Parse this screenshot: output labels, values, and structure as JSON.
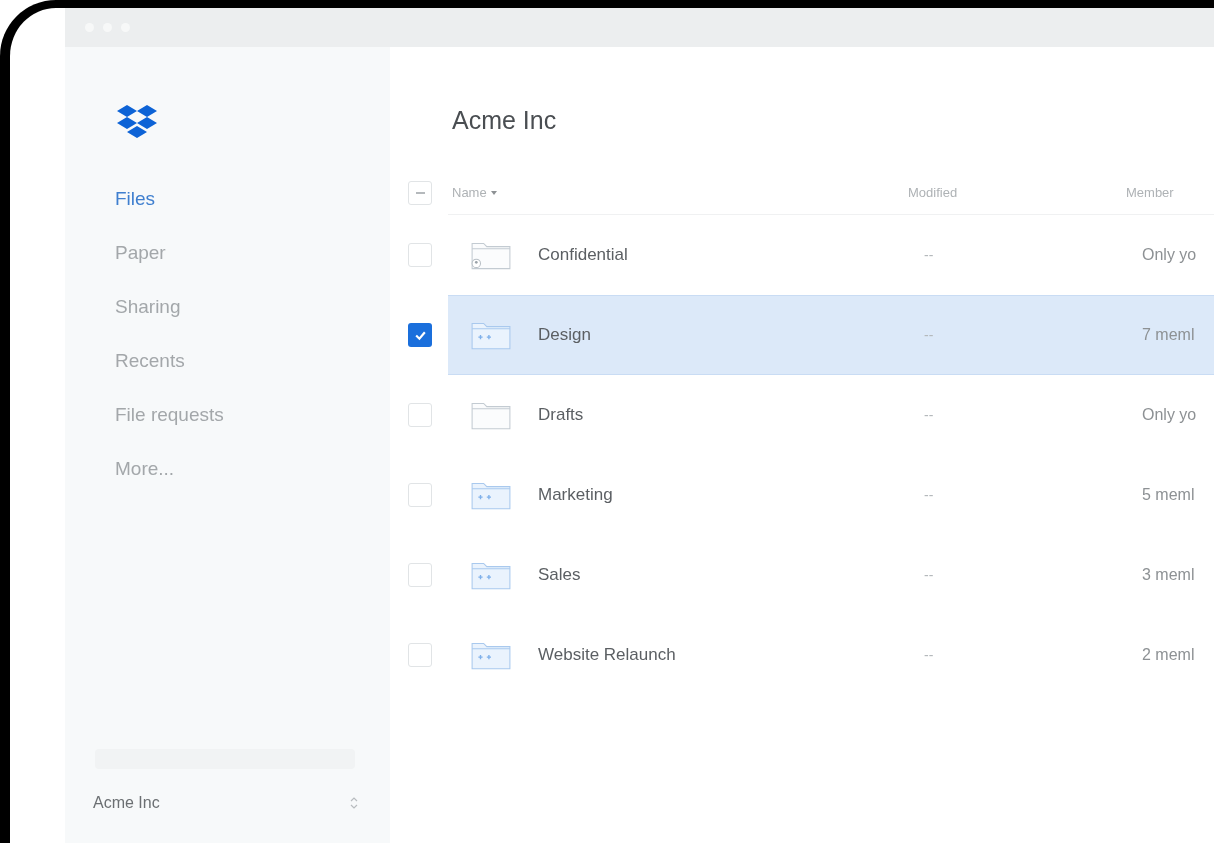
{
  "sidebar": {
    "items": [
      {
        "label": "Files",
        "selected": true
      },
      {
        "label": "Paper",
        "selected": false
      },
      {
        "label": "Sharing",
        "selected": false
      },
      {
        "label": "Recents",
        "selected": false
      },
      {
        "label": "File requests",
        "selected": false
      },
      {
        "label": "More...",
        "selected": false
      }
    ],
    "account": {
      "name": "Acme Inc"
    }
  },
  "main": {
    "title": "Acme Inc",
    "table": {
      "select_all": {
        "indeterminate": true
      },
      "columns": [
        {
          "label": "Name",
          "sorted": true
        },
        {
          "label": "Modified"
        },
        {
          "label": "Member"
        }
      ],
      "rows": [
        {
          "name": "Confidential",
          "kind": "confidential",
          "modified": "--",
          "members": "Only yo",
          "selected": false
        },
        {
          "name": "Design",
          "kind": "team",
          "modified": "--",
          "members": "7 meml",
          "selected": true
        },
        {
          "name": "Drafts",
          "kind": "plain",
          "modified": "--",
          "members": "Only yo",
          "selected": false
        },
        {
          "name": "Marketing",
          "kind": "team",
          "modified": "--",
          "members": "5 meml",
          "selected": false
        },
        {
          "name": "Sales",
          "kind": "team",
          "modified": "--",
          "members": "3 meml",
          "selected": false
        },
        {
          "name": "Website Relaunch",
          "kind": "team",
          "modified": "--",
          "members": "2 meml",
          "selected": false
        }
      ]
    }
  }
}
